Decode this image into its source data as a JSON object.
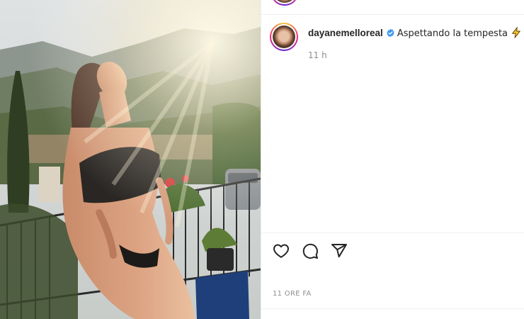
{
  "post": {
    "username": "dayanemelloreal",
    "verified": true,
    "caption": "Aspettando la tempesta",
    "caption_emoji": "high-voltage-icon",
    "time_ago": "11 h",
    "date_label": "11 ORE FA"
  },
  "actions": [
    {
      "name": "like-button",
      "icon": "heart-icon"
    },
    {
      "name": "comment-button",
      "icon": "comment-icon"
    },
    {
      "name": "share-button",
      "icon": "paper-plane-icon"
    }
  ],
  "colors": {
    "verified_blue": "#3897f0",
    "muted_text": "#8e8e8e",
    "text": "#262626",
    "emoji_yellow": "#f7c325"
  }
}
